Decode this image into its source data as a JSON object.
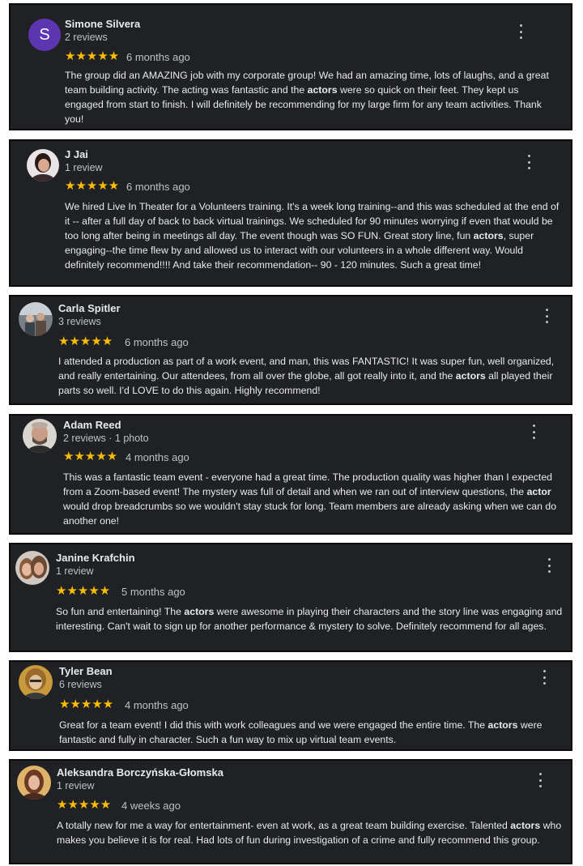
{
  "reviews": [
    {
      "name": "Simone Silvera",
      "meta": "2 reviews",
      "stars": "★★★★★",
      "rating": 5,
      "when": "6 months ago",
      "avatar_initial": "S",
      "avatar_color": "#5e35b1",
      "text_before": "The group did an AMAZING job with my corporate group! We had an amazing time, lots of laughs, and a great team building activity. The acting was fantastic and the ",
      "keyword": "actors",
      "text_after": " were so quick on their feet. They kept us engaged from start to finish. I will definitely be recommending for my large firm for any team activities. Thank you!"
    },
    {
      "name": "J Jai",
      "meta": "1 review",
      "stars": "★★★★★",
      "rating": 5,
      "when": "6 months ago",
      "text_before": "We hired Live In Theater for a Volunteers training. It's a week long training--and this was scheduled at the end of it -- after a full day of back to back virtual trainings. We scheduled for 90 minutes worrying if even that would be too long after being in meetings all day. The event though was SO FUN. Great story line, fun ",
      "keyword": "actors",
      "text_after": ", super engaging--the time flew by and allowed us to interact with our volunteers in a whole different way. Would definitely recommend!!!!  And take their recommendation-- 90 - 120 minutes. Such a great time!"
    },
    {
      "name": "Carla Spitler",
      "meta": "3 reviews",
      "stars": "★★★★★",
      "rating": 5,
      "when": "6 months ago",
      "text_before": "I attended a production as part of a work event, and man, this was FANTASTIC! It was super fun, well organized, and really entertaining. Our attendees, from all over the globe, all got really into it, and the ",
      "keyword": "actors",
      "text_after": " all played their parts so well. I'd LOVE to do this again. Highly recommend!"
    },
    {
      "name": "Adam Reed",
      "meta": "2 reviews · 1 photo",
      "stars": "★★★★★",
      "rating": 5,
      "when": "4 months ago",
      "text_before": "This was a fantastic team event - everyone had a great time. The production quality was higher than I expected from a Zoom-based event! The mystery was full of detail and when we ran out of interview questions, the ",
      "keyword": "actor",
      "text_after": " would drop breadcrumbs so we wouldn't stay stuck for long. Team members are already asking when we can do another one!"
    },
    {
      "name": "Janine Krafchin",
      "meta": "1 review",
      "stars": "★★★★★",
      "rating": 5,
      "when": "5 months ago",
      "text_before": "So fun and entertaining! The ",
      "keyword": "actors",
      "text_after": " were awesome in playing their characters and the story line was engaging and interesting.  Can't wait to sign up for another performance & mystery to solve.  Definitely recommend for all ages."
    },
    {
      "name": "Tyler Bean",
      "meta": "6 reviews",
      "stars": "★★★★★",
      "rating": 5,
      "when": "4 months ago",
      "text_before": "Great for a team event! I did this with work colleagues and we were engaged the entire time. The ",
      "keyword": "actors",
      "text_after": " were fantastic and fully in character. Such a fun way to mix up virtual team events."
    },
    {
      "name": "Aleksandra Borczyńska-Głomska",
      "meta": "1 review",
      "stars": "★★★★★",
      "rating": 5,
      "when": "4 weeks ago",
      "text_before": "A totally new for me a way for entertainment- even at work, as a great team building exercise. Talented ",
      "keyword": "actors",
      "text_after": " who makes you believe it is for real. Had lots of fun during investigation of a crime and fully recommend this group."
    }
  ]
}
